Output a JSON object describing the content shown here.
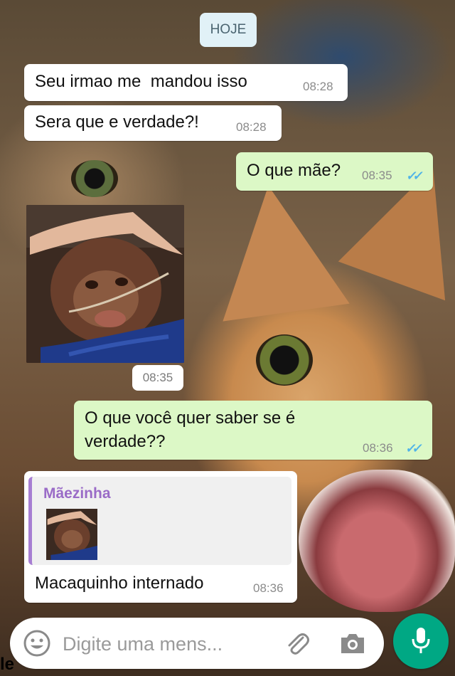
{
  "date_chip": "HOJE",
  "messages": [
    {
      "text": "Seu irmao me  mandou isso",
      "time": "08:28"
    },
    {
      "text": "Sera que e verdade?!",
      "time": "08:28"
    },
    {
      "text": "O que mãe?",
      "time": "08:35"
    },
    {
      "time": "08:35"
    },
    {
      "line1": "O que você quer saber se é",
      "line2": "verdade??",
      "time": "08:36"
    },
    {
      "reply_name": "Mãezinha",
      "text": "Macaquinho internado",
      "time": "08:36"
    }
  ],
  "composer": {
    "placeholder": "Digite uma mens..."
  },
  "edge_text": "le",
  "icons": {
    "emoji": "smiley-icon",
    "attach": "paperclip-icon",
    "camera": "camera-icon",
    "mic": "microphone-icon",
    "read": "double-check-icon"
  },
  "colors": {
    "incoming": "#ffffff",
    "outgoing": "#dcf8c6",
    "read_ticks": "#4fb3e8",
    "reply_name": "#9a6bc7",
    "mic_button": "#00a884"
  }
}
